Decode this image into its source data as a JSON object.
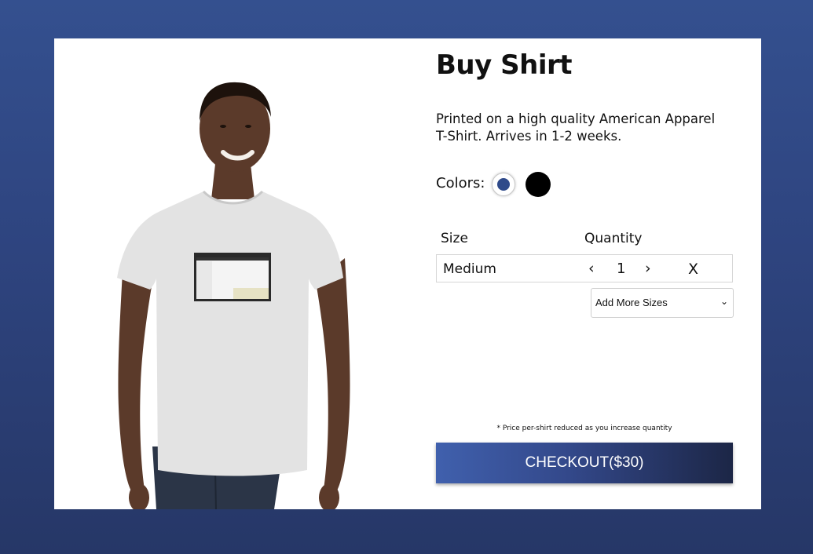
{
  "product": {
    "title": "Buy Shirt",
    "description": "Printed on a high quality American Apparel T-Shirt. Arrives in 1-2 weeks."
  },
  "colors": {
    "label": "Colors:",
    "options": [
      {
        "name": "navy",
        "hex": "#2f4a8a",
        "selected": true
      },
      {
        "name": "black",
        "hex": "#000000",
        "selected": false
      }
    ]
  },
  "order": {
    "size_header": "Size",
    "quantity_header": "Quantity",
    "items": [
      {
        "size": "Medium",
        "quantity": "1",
        "decrement": "‹",
        "increment": "›",
        "remove": "X"
      }
    ],
    "add_sizes_label": "Add More Sizes"
  },
  "price_note": "* Price per-shirt reduced as you increase quantity",
  "checkout_label": "CHECKOUT($30)",
  "theme": {
    "background": "#2e447f",
    "button_start": "#4060ad",
    "button_end": "#1c2646"
  }
}
